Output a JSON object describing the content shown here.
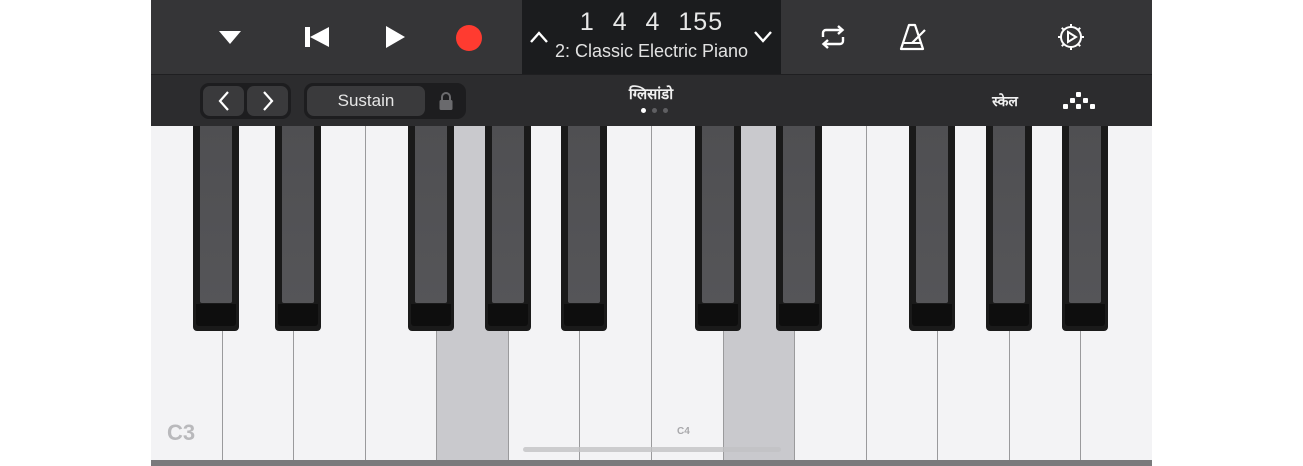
{
  "transport": {
    "counter": "1  4  4  155",
    "instrument": "2: Classic Electric Piano"
  },
  "controls": {
    "sustain_label": "Sustain",
    "mode_label": "ग्लिसांडो",
    "scale_label": "स्केल",
    "page_dots_count": 3,
    "active_page": 1
  },
  "keyboard": {
    "label_c3": "C3",
    "label_c4": "C4"
  },
  "colors": {
    "record": "#ff3b30",
    "toolbar": "#353537",
    "lcd": "#1b1c1e",
    "white_key": "#f3f3f5",
    "pressed_key": "#c9c9cd",
    "black_key": "#1a1a1a"
  },
  "icons": {
    "menu": "triangle-down-icon",
    "rewind": "skip-back-icon",
    "play": "play-icon",
    "record": "record-icon",
    "prev_song": "chevron-up-icon",
    "next_song": "chevron-down-icon",
    "loop": "loop-icon",
    "metronome": "metronome-icon",
    "settings": "gear-icon",
    "octave_down": "chevron-left-icon",
    "octave_up": "chevron-right-icon",
    "lock": "lock-icon",
    "arpeggiator": "arpeggiator-icon"
  }
}
